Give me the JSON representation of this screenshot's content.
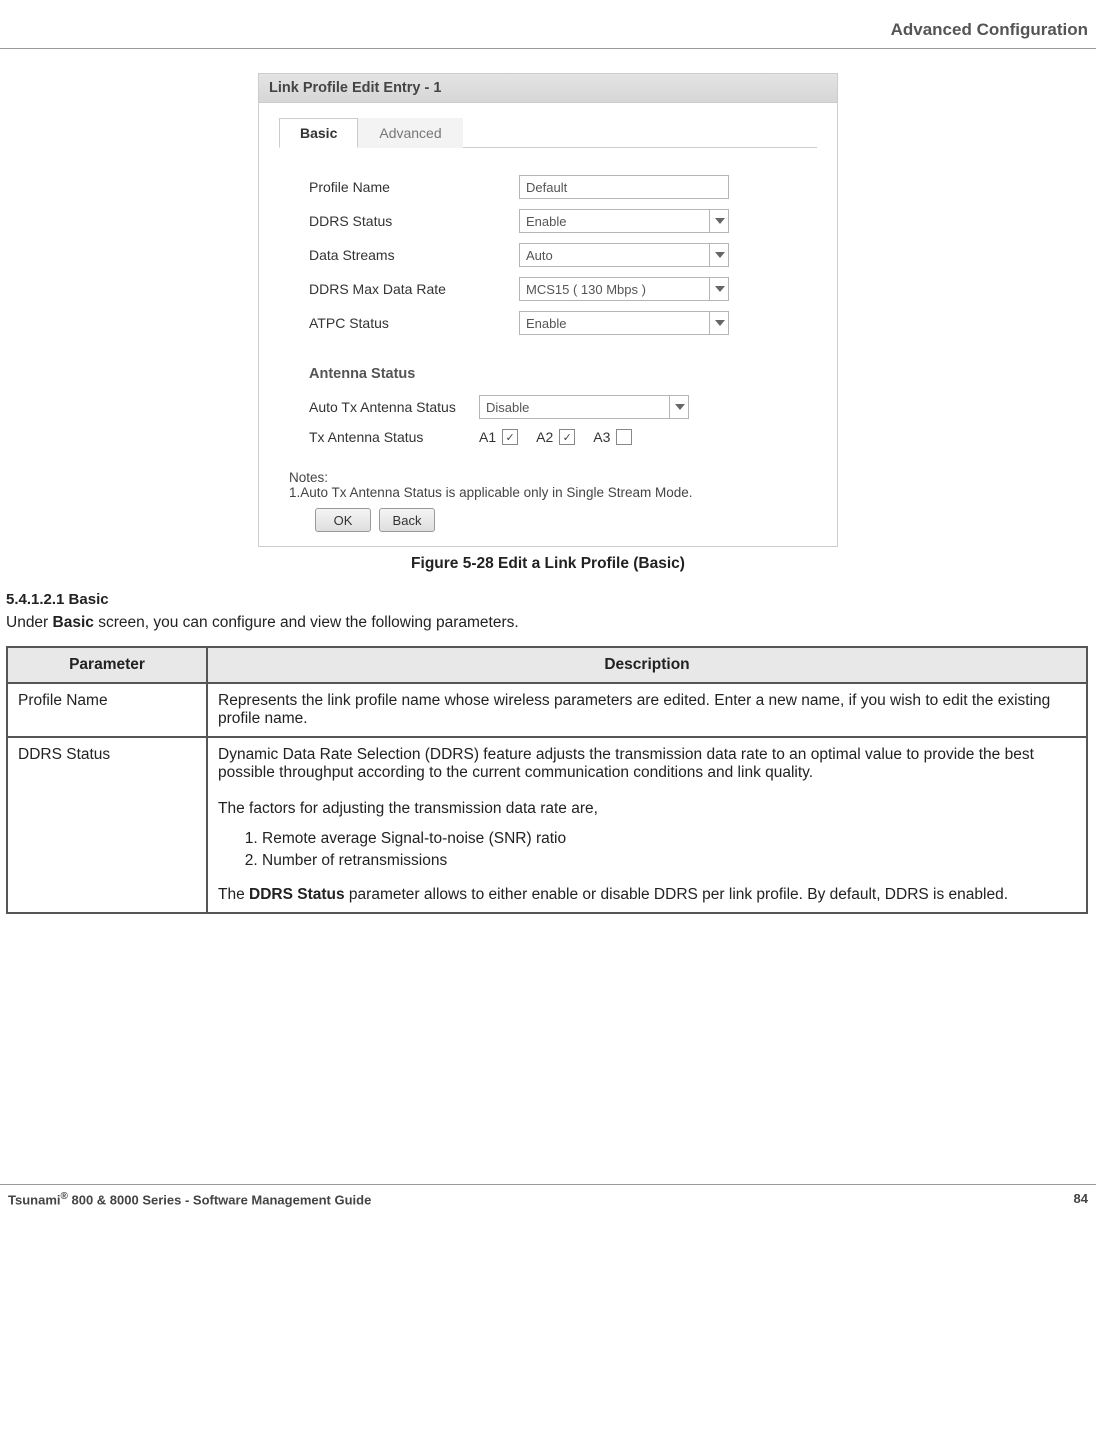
{
  "header": {
    "title": "Advanced Configuration"
  },
  "panel": {
    "title": "Link Profile Edit Entry - 1",
    "tabs": {
      "basic": "Basic",
      "advanced": "Advanced"
    },
    "fields": {
      "profile_name": {
        "label": "Profile Name",
        "value": "Default"
      },
      "ddrs_status": {
        "label": "DDRS Status",
        "value": "Enable"
      },
      "data_streams": {
        "label": "Data Streams",
        "value": "Auto"
      },
      "ddrs_max": {
        "label": "DDRS Max Data Rate",
        "value": "MCS15   ( 130 Mbps )"
      },
      "atpc_status": {
        "label": "ATPC Status",
        "value": "Enable"
      }
    },
    "antenna_section": {
      "title": "Antenna Status"
    },
    "antenna": {
      "auto_tx": {
        "label": "Auto Tx Antenna Status",
        "value": "Disable"
      },
      "tx_status": {
        "label": "Tx Antenna Status",
        "a1": "A1",
        "a2": "A2",
        "a3": "A3",
        "a1_checked": "✓",
        "a2_checked": "✓",
        "a3_checked": ""
      }
    },
    "notes": {
      "heading": "Notes:",
      "line1": "1.Auto Tx Antenna Status is applicable only in Single Stream Mode."
    },
    "buttons": {
      "ok": "OK",
      "back": "Back"
    }
  },
  "figure": {
    "caption": "Figure 5-28 Edit a Link Profile (Basic)"
  },
  "section": {
    "number": "5.4.1.2.1 Basic",
    "intro_pre": "Under ",
    "intro_bold": "Basic",
    "intro_post": " screen, you can configure and view the following parameters."
  },
  "table": {
    "head_param": "Parameter",
    "head_desc": "Description",
    "rows": {
      "profile_name": {
        "param": "Profile Name",
        "desc": "Represents the link profile name whose wireless parameters are edited. Enter a new name, if you wish to edit the existing profile name."
      },
      "ddrs_status": {
        "param": "DDRS Status",
        "p1": "Dynamic Data Rate Selection (DDRS) feature adjusts the transmission data rate to an optimal value to provide the best possible throughput according to the current communication conditions and link quality.",
        "p2": "The factors for adjusting the transmission data rate are,",
        "li1": "Remote average Signal-to-noise (SNR) ratio",
        "li2": "Number of retransmissions",
        "p3a": "The ",
        "p3b": "DDRS Status",
        "p3c": " parameter allows to either enable or disable DDRS per link profile. By default, DDRS is enabled."
      }
    }
  },
  "footer": {
    "left_a": "Tsunami",
    "left_sup": "®",
    "left_b": " 800 & 8000 Series - Software Management Guide",
    "page": "84"
  }
}
